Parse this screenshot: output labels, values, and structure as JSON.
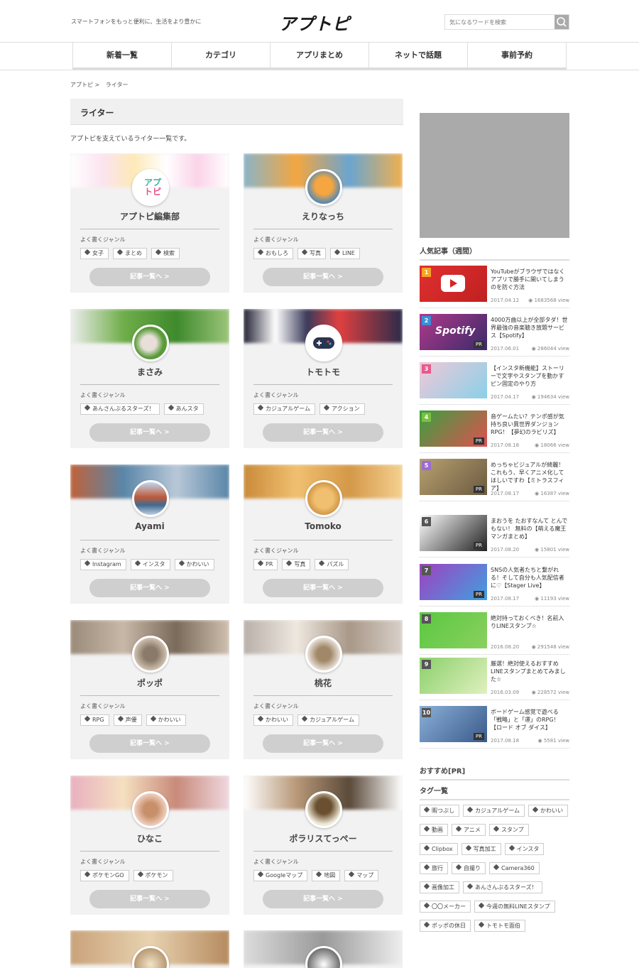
{
  "header": {
    "tagline": "スマートフォンをもっと便利に、生活をより豊かに",
    "logo": "アプトピ",
    "search_placeholder": "気になるワードを検索"
  },
  "nav": [
    "新着一覧",
    "カテゴリ",
    "アプリまとめ",
    "ネットで話題",
    "事前予約"
  ],
  "breadcrumb": [
    "アプトピ >",
    "ライター"
  ],
  "page": {
    "title": "ライター",
    "description": "アプトピを支えているライター一覧です。"
  },
  "writers": [
    {
      "name": "アプトピ編集部",
      "genre_label": "よく書くジャンル",
      "tags": [
        "女子",
        "まとめ",
        "検索"
      ],
      "button": "記事一覧へ >"
    },
    {
      "name": "えりなっち",
      "genre_label": "よく書くジャンル",
      "tags": [
        "おもしろ",
        "写真",
        "LINE"
      ],
      "button": "記事一覧へ >"
    },
    {
      "name": "まさみ",
      "genre_label": "よく書くジャンル",
      "tags": [
        "あんさんぶるスターズ！",
        "あんスタ"
      ],
      "button": "記事一覧へ >"
    },
    {
      "name": "トモトモ",
      "genre_label": "よく書くジャンル",
      "tags": [
        "カジュアルゲーム",
        "アクション"
      ],
      "button": "記事一覧へ >"
    },
    {
      "name": "Ayami",
      "genre_label": "よく書くジャンル",
      "tags": [
        "Instagram",
        "インスタ",
        "かわいい"
      ],
      "button": "記事一覧へ >"
    },
    {
      "name": "Tomoko",
      "genre_label": "よく書くジャンル",
      "tags": [
        "PR",
        "写真",
        "パズル"
      ],
      "button": "記事一覧へ >"
    },
    {
      "name": "ポッポ",
      "genre_label": "よく書くジャンル",
      "tags": [
        "RPG",
        "声優",
        "かわいい"
      ],
      "button": "記事一覧へ >"
    },
    {
      "name": "桃花",
      "genre_label": "よく書くジャンル",
      "tags": [
        "かわいい",
        "カジュアルゲーム"
      ],
      "button": "記事一覧へ >"
    },
    {
      "name": "ひなこ",
      "genre_label": "よく書くジャンル",
      "tags": [
        "ポケモンGO",
        "ポケモン"
      ],
      "button": "記事一覧へ >"
    },
    {
      "name": "ポラリスてっぺー",
      "genre_label": "よく書くジャンル",
      "tags": [
        "Googleマップ",
        "地図",
        "マップ"
      ],
      "button": "記事一覧へ >"
    }
  ],
  "sidebar": {
    "popular_heading": "人気記事（週間）",
    "ranking": [
      {
        "rank": "1",
        "title": "YouTubeがブラウザではなくアプリで勝手に開いてしまうのを防ぐ方法",
        "date": "2017.04.12",
        "views": "1683568 view",
        "pr": ""
      },
      {
        "rank": "2",
        "title": "4000万曲以上が全部タダ！世界最強の音楽聴き放題サービス【Spotify】",
        "date": "2017.06.01",
        "views": "286044 view",
        "pr": "PR"
      },
      {
        "rank": "3",
        "title": "【インスタ新機能】ストーリーで文字やスタンプを動かすピン固定のやり方",
        "date": "2017.04.17",
        "views": "194634 view",
        "pr": ""
      },
      {
        "rank": "4",
        "title": "音ゲームたい？テンポ感が気持ち良い異世界ダンジョンRPG！【夢幻のラビリズ】",
        "date": "2017.08.18",
        "views": "18066 view",
        "pr": "PR"
      },
      {
        "rank": "5",
        "title": "めっちゃビジュアルが綺麗！これもう、早くアニメ化してほしいですわ【ミトラスフィア】",
        "date": "2017.08.17",
        "views": "16387 view",
        "pr": "PR"
      },
      {
        "rank": "6",
        "title": "まおうを たおすなんて とんでもない！ 無料の【萌える魔王マンガまとめ】",
        "date": "2017.08.20",
        "views": "15801 view",
        "pr": "PR"
      },
      {
        "rank": "7",
        "title": "SNSの人気者たちと繋がれる！そして自分も人気配信者に♡【Stager Live】",
        "date": "2017.08.17",
        "views": "11193 view",
        "pr": "PR"
      },
      {
        "rank": "8",
        "title": "絶対持っておくべき！名前入りLINEスタンプ☆",
        "date": "2016.08.20",
        "views": "291548 view",
        "pr": ""
      },
      {
        "rank": "9",
        "title": "厳選！絶対使えるおすすめLINEスタンプまとめてみました☆",
        "date": "2016.03.09",
        "views": "228572 view",
        "pr": ""
      },
      {
        "rank": "10",
        "title": "ボードゲーム感覚で遊べる「戦略」と「運」のRPG！【ロード オブ ダイス】",
        "date": "2017.08.18",
        "views": "5581 view",
        "pr": "PR"
      }
    ],
    "recommend_heading": "おすすめ[PR]",
    "tags_heading": "タグ一覧",
    "tags": [
      "暇つぶし",
      "カジュアルゲーム",
      "かわいい",
      "動画",
      "アニメ",
      "スタンプ",
      "Clipbox",
      "写真加工",
      "インスタ",
      "旅行",
      "自撮り",
      "Camera360",
      "画像加工",
      "あんさんぶるスターズ！",
      "〇〇メーカー",
      "今週の無料LINEスタンプ",
      "ポッポの休日",
      "トモトモ面伯"
    ]
  },
  "colors": {
    "accent": "#f5a623",
    "rank_colors": [
      "#f5a623",
      "#3a8fd8",
      "#e85a8a",
      "#7ac143",
      "#9b6bd8",
      "#555555",
      "#555555",
      "#555555",
      "#555555",
      "#555555"
    ]
  }
}
